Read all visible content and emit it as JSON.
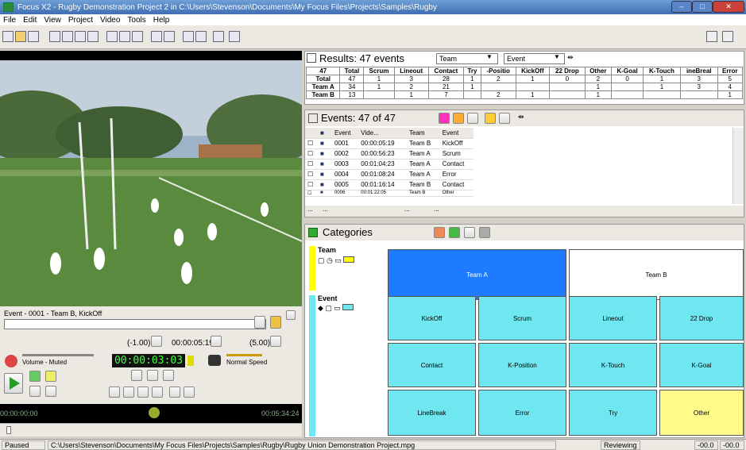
{
  "title": "Focus X2 - Rugby Demonstration Project 2 in C:\\Users\\Stevenson\\Documents\\My Focus Files\\Projects\\Samples\\Rugby",
  "menu": [
    "File",
    "Edit",
    "View",
    "Project",
    "Video",
    "Tools",
    "Help"
  ],
  "results": {
    "title": "Results: 47 events",
    "row_dropdown": "Team",
    "col_dropdown": "Event",
    "headers": [
      "47",
      "Total",
      "Scrum",
      "Lineout",
      "Contact",
      "Try",
      "-Positio",
      "KickOff",
      "22 Drop",
      "Other",
      "K-Goal",
      "K-Touch",
      "ineBreal",
      "Error"
    ],
    "rows": [
      [
        "Total",
        "47",
        "1",
        "3",
        "28",
        "1",
        "2",
        "1",
        "0",
        "2",
        "0",
        "1",
        "3",
        "5"
      ],
      [
        "Team A",
        "34",
        "1",
        "2",
        "21",
        "1",
        "",
        "",
        "",
        "1",
        "",
        "1",
        "3",
        "4"
      ],
      [
        "Team B",
        "13",
        "",
        "1",
        "7",
        "",
        "2",
        "1",
        "",
        "1",
        "",
        "",
        "",
        "1"
      ]
    ]
  },
  "events": {
    "title": "Events: 47 of 47",
    "headers": [
      "Event",
      "Vide...",
      "Team",
      "Event"
    ],
    "rows": [
      [
        "0001",
        "00:00:05:19",
        "Team B",
        "KickOff"
      ],
      [
        "0002",
        "00:00:56:23",
        "Team A",
        "Scrum"
      ],
      [
        "0003",
        "00:01:04:23",
        "Team A",
        "Contact"
      ],
      [
        "0004",
        "00:01:08:24",
        "Team A",
        "Error"
      ],
      [
        "0005",
        "00:01:16:14",
        "Team B",
        "Contact"
      ],
      [
        "0006",
        "00:01:22:05",
        "Team B",
        "Other"
      ]
    ],
    "footer": [
      "...",
      "...",
      "...",
      "..."
    ]
  },
  "categories": {
    "title": "Categories",
    "team_label": "Team",
    "event_label": "Event",
    "team": [
      "Team A",
      "Team B"
    ],
    "event": [
      "KickOff",
      "Scrum",
      "Lineout",
      "22 Drop",
      "Contact",
      "K-Position",
      "K-Touch",
      "K-Goal",
      "LineBreak",
      "Error",
      "Try",
      "Other"
    ]
  },
  "player": {
    "event_label": "Event - 0001 - Team B, KickOff",
    "minus": "(-1.00)",
    "time_small": "00:00:05:19",
    "plus": "(5.00)",
    "volume": "Volume - Muted",
    "timecode": "00:00:03:03",
    "speed": "Normal Speed",
    "start": "00:00:00:00",
    "end": "00:05:34:24"
  },
  "status": {
    "state": "Paused",
    "path": "C:\\Users\\Stevenson\\Documents\\My Focus Files\\Projects\\Samples\\Rugby\\Rugby Union Demonstration Project.mpg",
    "mode": "Reviewing",
    "v1": "-00.0",
    "v2": "-00.0"
  }
}
